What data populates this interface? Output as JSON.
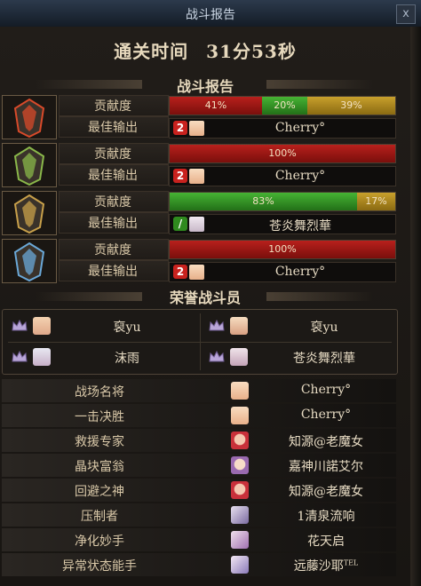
{
  "window": {
    "title": "战斗报告",
    "close_label": "x"
  },
  "header": {
    "clear_label": "通关时间",
    "clear_time": "31分53秒"
  },
  "sections": {
    "battle_report": "战斗报告",
    "honor": "荣誉战斗员"
  },
  "row_labels": {
    "contribution": "贡献度",
    "best_output": "最佳输出"
  },
  "players": [
    {
      "class_icon": "red-emblem-icon",
      "segments": [
        {
          "pct": 41,
          "label": "41%",
          "color": "red"
        },
        {
          "pct": 20,
          "label": "20%",
          "color": "green"
        },
        {
          "pct": 39,
          "label": "39%",
          "color": "gold"
        }
      ],
      "best_badge": "2",
      "best_badge_color": "red",
      "best_name": "Cherry°"
    },
    {
      "class_icon": "green-emblem-icon",
      "segments": [
        {
          "pct": 100,
          "label": "100%",
          "color": "red"
        }
      ],
      "best_badge": "2",
      "best_badge_color": "red",
      "best_name": "Cherry°"
    },
    {
      "class_icon": "gold-emblem-icon",
      "segments": [
        {
          "pct": 83,
          "label": "83%",
          "color": "green"
        },
        {
          "pct": 17,
          "label": "17%",
          "color": "gold"
        }
      ],
      "best_badge": "/",
      "best_badge_color": "green",
      "best_name": "苍炎舞烈華"
    },
    {
      "class_icon": "blue-emblem-icon",
      "segments": [
        {
          "pct": 100,
          "label": "100%",
          "color": "red"
        }
      ],
      "best_badge": "2",
      "best_badge_color": "red",
      "best_name": "Cherry°"
    }
  ],
  "honor_members": [
    {
      "name": "裒yu"
    },
    {
      "name": "裒yu"
    },
    {
      "name": "沫雨"
    },
    {
      "name": "苍炎舞烈華"
    }
  ],
  "awards": [
    {
      "title": "战场名将",
      "player": "Cherry°"
    },
    {
      "title": "一击决胜",
      "player": "Cherry°"
    },
    {
      "title": "救援专家",
      "player": "知源@老魔女"
    },
    {
      "title": "晶块富翁",
      "player": "嘉神川諾艾尔"
    },
    {
      "title": "回避之神",
      "player": "知源@老魔女"
    },
    {
      "title": "压制者",
      "player": "1清泉流响"
    },
    {
      "title": "净化妙手",
      "player": "花天启"
    },
    {
      "title": "异常状态能手",
      "player": "远藤沙耶",
      "player_suffix": "TEL"
    }
  ],
  "colors": {
    "bar_red": "#b8201c",
    "bar_green": "#46b334",
    "bar_gold": "#c8a02c",
    "panel": "#1a1714"
  }
}
